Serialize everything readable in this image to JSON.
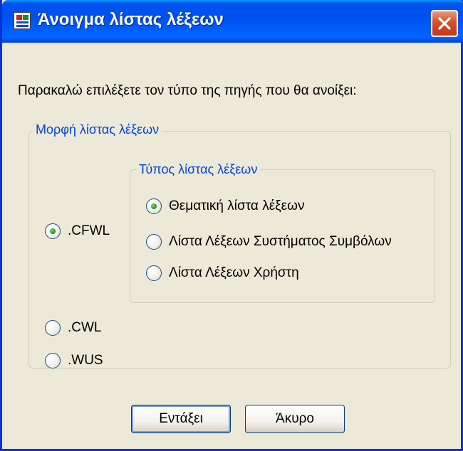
{
  "window": {
    "title": "Άνοιγμα λίστας λέξεων",
    "icon": "app-icon",
    "close_icon": "close-icon"
  },
  "prompt": "Παρακαλώ επιλέξετε τον τύπο της πηγής που θα ανοίξει:",
  "format_group": {
    "legend": "Μορφή λίστας λέξεων",
    "options": [
      {
        "label": ".CFWL",
        "checked": true
      },
      {
        "label": ".CWL",
        "checked": false
      },
      {
        "label": ".WUS",
        "checked": false
      }
    ]
  },
  "type_group": {
    "legend": "Τύπος λίστας λέξεων",
    "options": [
      {
        "label": "Θεματική λίστα λέξεων",
        "checked": true
      },
      {
        "label": "Λίστα Λέξεων Συστήματος Συμβόλων",
        "checked": false
      },
      {
        "label": "Λίστα Λέξεων Χρήστη",
        "checked": false
      }
    ]
  },
  "buttons": {
    "ok": "Εντάξει",
    "cancel": "Άκυρο"
  },
  "colors": {
    "titlebar": "#0054E3",
    "accent_text": "#0046D5",
    "face": "#ECE9D8",
    "radio_dot": "#21A121"
  }
}
